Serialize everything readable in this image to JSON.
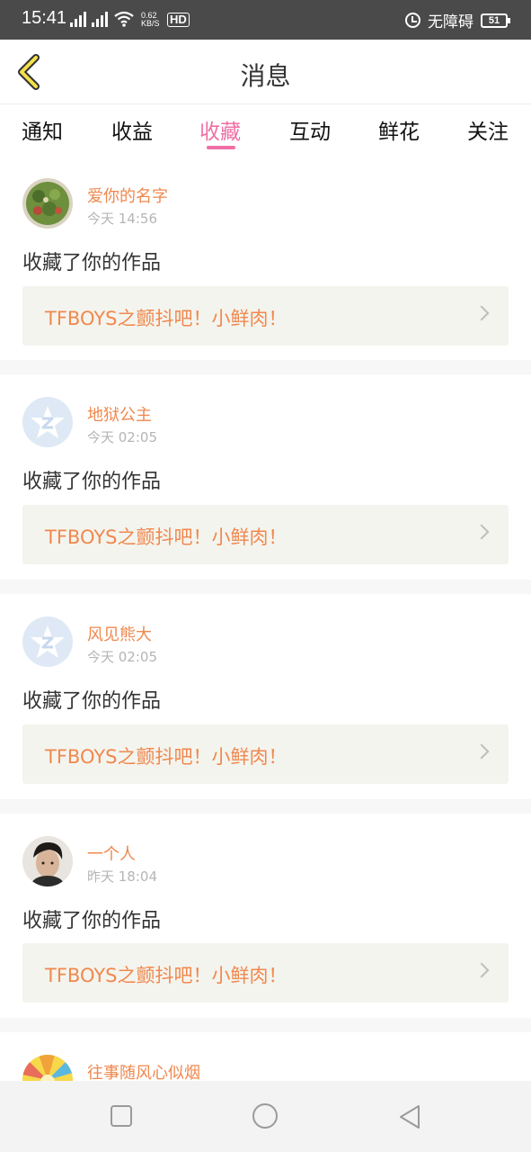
{
  "status_bar": {
    "time": "15:41",
    "net1": "4G",
    "net2": "4G",
    "speed_value": "0.62",
    "speed_unit": "KB/S",
    "hd": "HD",
    "accessibility": "无障碍",
    "battery": "51"
  },
  "header": {
    "title": "消息"
  },
  "tabs": [
    {
      "label": "通知"
    },
    {
      "label": "收益"
    },
    {
      "label": "收藏",
      "active": true
    },
    {
      "label": "互动"
    },
    {
      "label": "鲜花"
    },
    {
      "label": "关注"
    }
  ],
  "messages": [
    {
      "user": "爱你的名字",
      "time": "今天 14:56",
      "action": "收藏了你的作品",
      "work": "TFBOYS之颤抖吧！小鲜肉！",
      "avatar": "food-photo-avatar"
    },
    {
      "user": "地狱公主",
      "time": "今天 02:05",
      "action": "收藏了你的作品",
      "work": "TFBOYS之颤抖吧！小鲜肉！",
      "avatar": "default-star-avatar"
    },
    {
      "user": "风见熊大",
      "time": "今天 02:05",
      "action": "收藏了你的作品",
      "work": "TFBOYS之颤抖吧！小鲜肉！",
      "avatar": "default-star-avatar"
    },
    {
      "user": "一个人",
      "time": "昨天 18:04",
      "action": "收藏了你的作品",
      "work": "TFBOYS之颤抖吧！小鲜肉！",
      "avatar": "person-photo-avatar"
    },
    {
      "user": "往事随风心似烟",
      "time": "",
      "action": "",
      "work": "",
      "avatar": "colorful-photo-avatar"
    }
  ],
  "nav": {
    "icons": [
      "square-recents-icon",
      "circle-home-icon",
      "triangle-back-icon"
    ]
  },
  "colors": {
    "accent": "#f06fa5",
    "username": "#f0884e",
    "work_bg": "#f4f4ee"
  }
}
